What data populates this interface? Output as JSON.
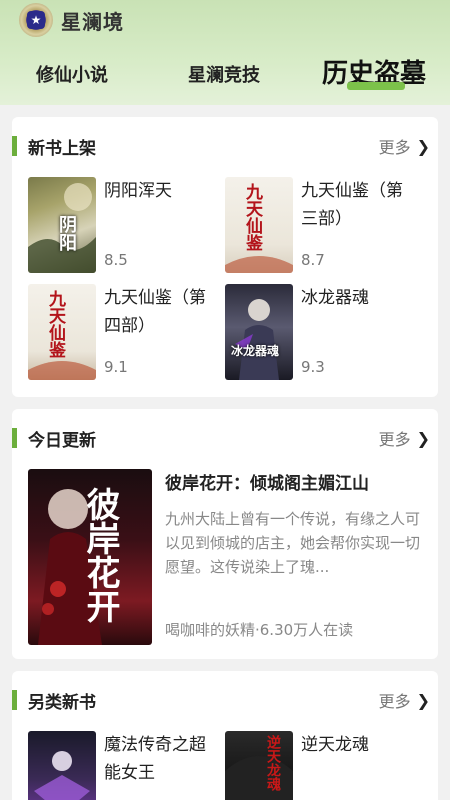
{
  "app": {
    "title": "星澜境",
    "logo_icon": "star-logo-icon"
  },
  "tabs": [
    {
      "label": "修仙小说"
    },
    {
      "label": "星澜竞技"
    },
    {
      "label": "历史盗墓",
      "active": true
    }
  ],
  "colors": {
    "accent": "#6cae3c",
    "tab_highlight": "#7cc24a",
    "header_bg": "#d3e8c2"
  },
  "sections": {
    "new_books": {
      "title": "新书上架",
      "more": "更多",
      "books": [
        {
          "title": "阴阳浑天",
          "score": "8.5",
          "cover_text": "阴阳"
        },
        {
          "title": "九天仙鉴（第三部）",
          "score": "8.7",
          "cover_text": "九天仙鉴"
        },
        {
          "title": "九天仙鉴（第四部）",
          "score": "9.1",
          "cover_text": "九天仙鉴"
        },
        {
          "title": "冰龙器魂",
          "score": "9.3",
          "cover_text": "冰龙器魂"
        }
      ]
    },
    "today_update": {
      "title": "今日更新",
      "more": "更多",
      "book": {
        "title": "彼岸花开：倾城阁主媚江山",
        "desc": "九州大陆上曾有一个传说，有缘之人可以见到倾城的店主，她会帮你实现一切愿望。这传说染上了瑰...",
        "meta": "喝咖啡的妖精·6.30万人在读",
        "cover_text": "彼岸花开"
      }
    },
    "other_new": {
      "title": "另类新书",
      "more": "更多",
      "books": [
        {
          "title": "魔法传奇之超能女王",
          "cover_text": ""
        },
        {
          "title": "逆天龙魂",
          "cover_text": "逆天龙魂"
        }
      ]
    }
  }
}
